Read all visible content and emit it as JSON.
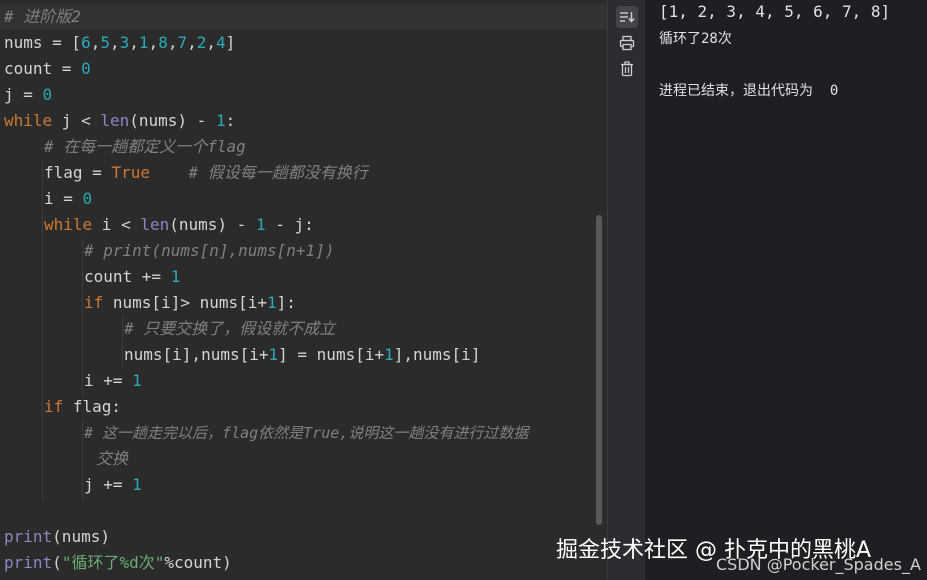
{
  "editor": {
    "lines": {
      "l1": "# 进阶版2",
      "l2a": "nums = [",
      "l2b": "6",
      "l2c": ",",
      "l2d": "5",
      "l2e": ",",
      "l2f": "3",
      "l2g": ",",
      "l2h": "1",
      "l2i": ",",
      "l2j": "8",
      "l2k": ",",
      "l2l": "7",
      "l2m": ",",
      "l2n": "2",
      "l2o": ",",
      "l2p": "4",
      "l2q": "]",
      "l3a": "count = ",
      "l3b": "0",
      "l4a": "j = ",
      "l4b": "0",
      "l5a": "while",
      "l5b": " j < ",
      "l5c": "len",
      "l5d": "(nums) - ",
      "l5e": "1",
      "l5f": ":",
      "l6": "# 在每一趟都定义一个flag",
      "l7a": "flag = ",
      "l7b": "True",
      "l7c": "    # 假设每一趟都没有换行",
      "l8a": "i = ",
      "l8b": "0",
      "l9a": "while",
      "l9b": " i < ",
      "l9c": "len",
      "l9d": "(nums) - ",
      "l9e": "1",
      "l9f": " - j:",
      "l10": "# print(nums[n],nums[n+1])",
      "l11a": "count += ",
      "l11b": "1",
      "l12a": "if",
      "l12b": " nums[i]> nums[i+",
      "l12c": "1",
      "l12d": "]:",
      "l13": "# 只要交换了，假设就不成立",
      "l14a": "nums[i],nums[i+",
      "l14b": "1",
      "l14c": "] = nums[i+",
      "l14d": "1",
      "l14e": "],nums[i]",
      "l15a": "i += ",
      "l15b": "1",
      "l16a": "if",
      "l16b": " flag:",
      "l17": "# 这一趟走完以后，flag依然是True,说明这一趟没有进行过数据",
      "l18": "交换",
      "l19a": "j += ",
      "l19b": "1",
      "l21a": "print",
      "l21b": "(nums)",
      "l22a": "print",
      "l22b": "(",
      "l22c": "\"循环了%d次\"",
      "l22d": "%count)"
    }
  },
  "toolbar": {
    "icons": [
      "soft-wrap-icon",
      "print-icon",
      "trash-icon"
    ]
  },
  "console": {
    "output_list": "[1, 2, 3, 4, 5, 6, 7, 8]",
    "output_count": "循环了28次",
    "exit_message": "进程已结束，退出代码为  0"
  },
  "watermark": {
    "main": "掘金技术社区 @ 扑克中的黑桃A",
    "csdn": "CSDN @Pocker_Spades_A"
  },
  "colors": {
    "keyword": "#cc7832",
    "number": "#2aacb8",
    "comment": "#808080",
    "string": "#6aab73",
    "builtin": "#8888c6"
  }
}
